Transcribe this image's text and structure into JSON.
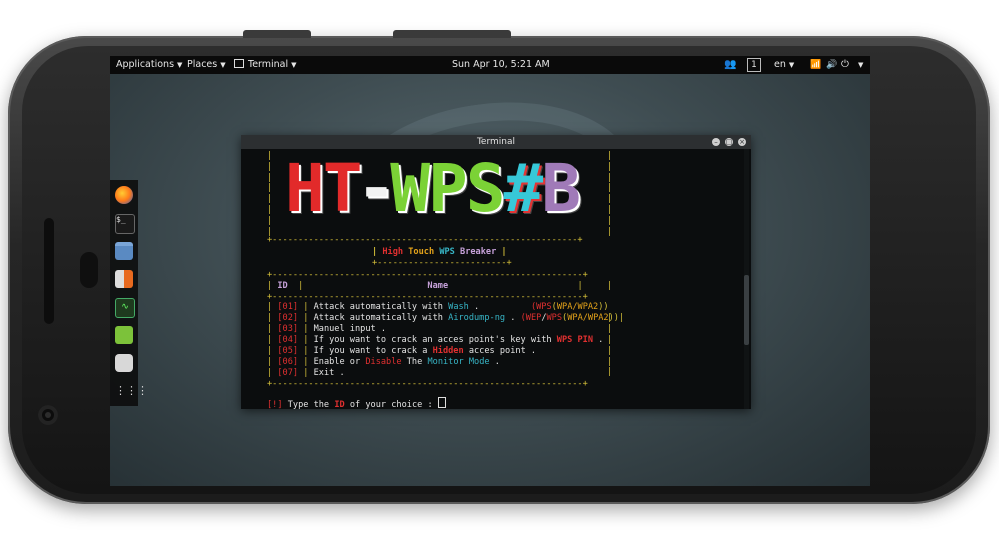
{
  "topbar": {
    "applications": "Applications",
    "places": "Places",
    "terminal": "Terminal",
    "clock": "Sun Apr 10,  5:21 AM",
    "workspace": "1",
    "lang": "en"
  },
  "terminal": {
    "title": "Terminal",
    "logo": [
      "HT",
      "-",
      "WPS",
      "#",
      "B"
    ],
    "subtitle": [
      "High",
      "Touch",
      "WPS",
      "Breaker"
    ],
    "col_id": "ID",
    "col_name": "Name",
    "menu": [
      {
        "id": "[01]",
        "pre": "Attack automatically with",
        "hl": "Wash",
        "post": " .",
        "tag": "(WPS(WPA/WPA2))"
      },
      {
        "id": "[02]",
        "pre": "Attack automatically with",
        "hl": "Airodump-ng",
        "post": " .",
        "tag": "(WEP/WPS(WPA/WPA2))"
      },
      {
        "id": "[03]",
        "pre": "Manuel input .",
        "hl": "",
        "post": "",
        "tag": ""
      },
      {
        "id": "[04]",
        "pre": "If you want to crack an acces point's key with",
        "hl": "WPS PIN",
        "post": " .",
        "tag": ""
      },
      {
        "id": "[05]",
        "pre": "If you want to crack a",
        "hl": "Hidden",
        "post": " acces point .",
        "tag": ""
      },
      {
        "id": "[06]",
        "pre": "Enable or",
        "hl": "Disable",
        "post": " The",
        "hl2": "Monitor Mode",
        "post2": " .",
        "tag": ""
      },
      {
        "id": "[07]",
        "pre": "Exit .",
        "hl": "",
        "post": "",
        "tag": ""
      }
    ],
    "prompt_mark": "[!]",
    "prompt_pre": "Type the",
    "prompt_id": "ID",
    "prompt_post": "of your choice :"
  },
  "colors": {
    "logo_ht": "#e22a2a",
    "logo_dash": "#f2f2f2",
    "logo_wps": "#7bd236",
    "logo_hash_a": "#37c8d8",
    "logo_hash_b": "#e23535",
    "logo_b": "#a07ab8"
  },
  "dock_icons": [
    "firefox-icon",
    "terminal-icon",
    "files-icon",
    "calculator-icon",
    "system-monitor-icon",
    "text-editor-icon",
    "keyring-icon",
    "app-grid-icon"
  ]
}
